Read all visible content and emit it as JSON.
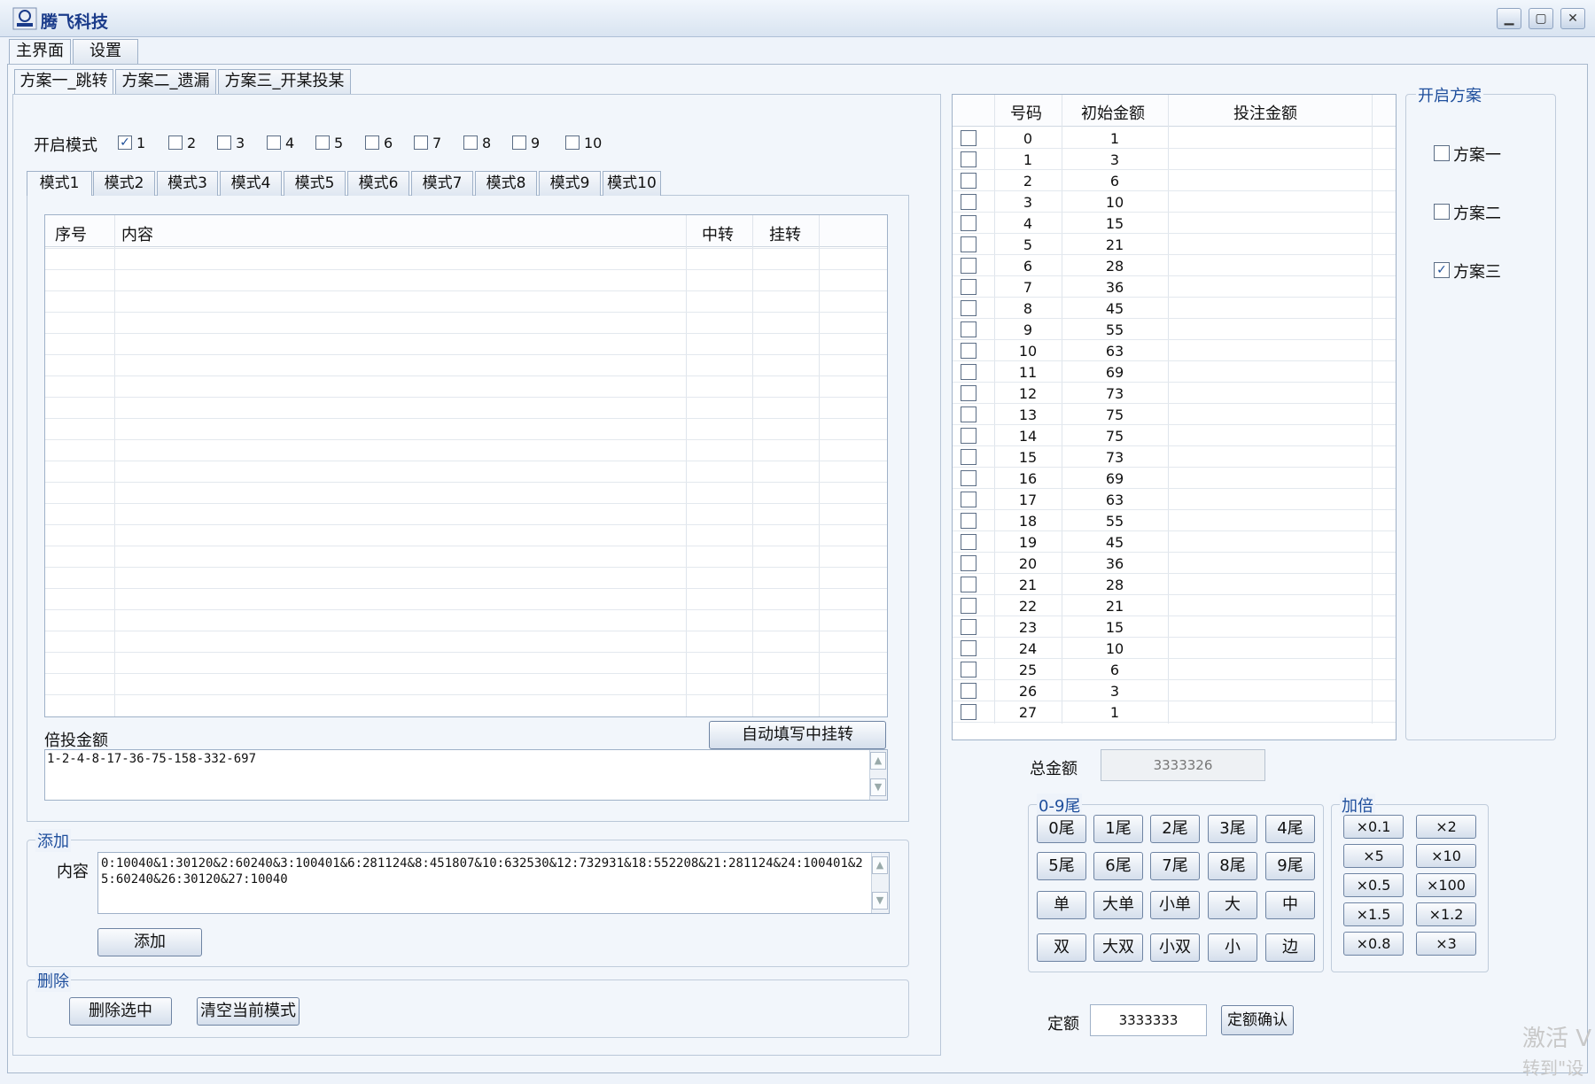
{
  "window": {
    "title": "腾飞科技",
    "controls": [
      "minimize",
      "maximize",
      "close"
    ]
  },
  "main_tabs": [
    {
      "label": "主界面"
    },
    {
      "label": "设置"
    }
  ],
  "scheme_tabs": [
    {
      "label": "方案一_跳转"
    },
    {
      "label": "方案二_遗漏"
    },
    {
      "label": "方案三_开某投某"
    }
  ],
  "enable_mode": {
    "label": "开启模式",
    "options": [
      {
        "label": "1",
        "checked": true
      },
      {
        "label": "2",
        "checked": false
      },
      {
        "label": "3",
        "checked": false
      },
      {
        "label": "4",
        "checked": false
      },
      {
        "label": "5",
        "checked": false
      },
      {
        "label": "6",
        "checked": false
      },
      {
        "label": "7",
        "checked": false
      },
      {
        "label": "8",
        "checked": false
      },
      {
        "label": "9",
        "checked": false
      },
      {
        "label": "10",
        "checked": false
      }
    ]
  },
  "mode_tabs": [
    {
      "label": "模式1"
    },
    {
      "label": "模式2"
    },
    {
      "label": "模式3"
    },
    {
      "label": "模式4"
    },
    {
      "label": "模式5"
    },
    {
      "label": "模式6"
    },
    {
      "label": "模式7"
    },
    {
      "label": "模式8"
    },
    {
      "label": "模式9"
    },
    {
      "label": "模式10"
    }
  ],
  "mode_table": {
    "columns": [
      "序号",
      "内容",
      "中转",
      "挂转"
    ],
    "rows": []
  },
  "multiplier": {
    "label": "倍投金额",
    "value": "1-2-4-8-17-36-75-158-332-697",
    "autofill_button": "自动填写中挂转"
  },
  "add_group": {
    "legend": "添加",
    "content_label": "内容",
    "content_value": "0:10040&1:30120&2:60240&3:100401&6:281124&8:451807&10:632530&12:732931&18:552208&21:281124&24:100401&25:60240&26:30120&27:10040",
    "add_button": "添加"
  },
  "delete_group": {
    "legend": "删除",
    "delete_selected_button": "删除选中",
    "clear_mode_button": "清空当前模式"
  },
  "number_table": {
    "columns": [
      "号码",
      "初始金额",
      "投注金额"
    ],
    "rows": [
      {
        "num": "0",
        "init": "1",
        "bet": ""
      },
      {
        "num": "1",
        "init": "3",
        "bet": ""
      },
      {
        "num": "2",
        "init": "6",
        "bet": ""
      },
      {
        "num": "3",
        "init": "10",
        "bet": ""
      },
      {
        "num": "4",
        "init": "15",
        "bet": ""
      },
      {
        "num": "5",
        "init": "21",
        "bet": ""
      },
      {
        "num": "6",
        "init": "28",
        "bet": ""
      },
      {
        "num": "7",
        "init": "36",
        "bet": ""
      },
      {
        "num": "8",
        "init": "45",
        "bet": ""
      },
      {
        "num": "9",
        "init": "55",
        "bet": ""
      },
      {
        "num": "10",
        "init": "63",
        "bet": ""
      },
      {
        "num": "11",
        "init": "69",
        "bet": ""
      },
      {
        "num": "12",
        "init": "73",
        "bet": ""
      },
      {
        "num": "13",
        "init": "75",
        "bet": ""
      },
      {
        "num": "14",
        "init": "75",
        "bet": ""
      },
      {
        "num": "15",
        "init": "73",
        "bet": ""
      },
      {
        "num": "16",
        "init": "69",
        "bet": ""
      },
      {
        "num": "17",
        "init": "63",
        "bet": ""
      },
      {
        "num": "18",
        "init": "55",
        "bet": ""
      },
      {
        "num": "19",
        "init": "45",
        "bet": ""
      },
      {
        "num": "20",
        "init": "36",
        "bet": ""
      },
      {
        "num": "21",
        "init": "28",
        "bet": ""
      },
      {
        "num": "22",
        "init": "21",
        "bet": ""
      },
      {
        "num": "23",
        "init": "15",
        "bet": ""
      },
      {
        "num": "24",
        "init": "10",
        "bet": ""
      },
      {
        "num": "25",
        "init": "6",
        "bet": ""
      },
      {
        "num": "26",
        "init": "3",
        "bet": ""
      },
      {
        "num": "27",
        "init": "1",
        "bet": ""
      }
    ]
  },
  "open_scheme": {
    "legend": "开启方案",
    "options": [
      {
        "label": "方案一",
        "checked": false
      },
      {
        "label": "方案二",
        "checked": false
      },
      {
        "label": "方案三",
        "checked": true
      }
    ]
  },
  "total": {
    "label": "总金额",
    "value": "3333326"
  },
  "tail_group": {
    "legend": "0-9尾",
    "rows": [
      [
        "0尾",
        "1尾",
        "2尾",
        "3尾",
        "4尾"
      ],
      [
        "5尾",
        "6尾",
        "7尾",
        "8尾",
        "9尾"
      ],
      [
        "单",
        "大单",
        "小单",
        "大",
        "中"
      ],
      [
        "双",
        "大双",
        "小双",
        "小",
        "边"
      ]
    ]
  },
  "multiply_group": {
    "legend": "加倍",
    "rows": [
      [
        "×0.1",
        "×2"
      ],
      [
        "×5",
        "×10"
      ],
      [
        "×0.5",
        "×100"
      ],
      [
        "×1.5",
        "×1.2"
      ],
      [
        "×0.8",
        "×3"
      ]
    ]
  },
  "fixed": {
    "label": "定额",
    "value": "3333333",
    "confirm_button": "定额确认"
  },
  "watermark": {
    "line1": "激活 V",
    "line2": "转到\"设"
  }
}
